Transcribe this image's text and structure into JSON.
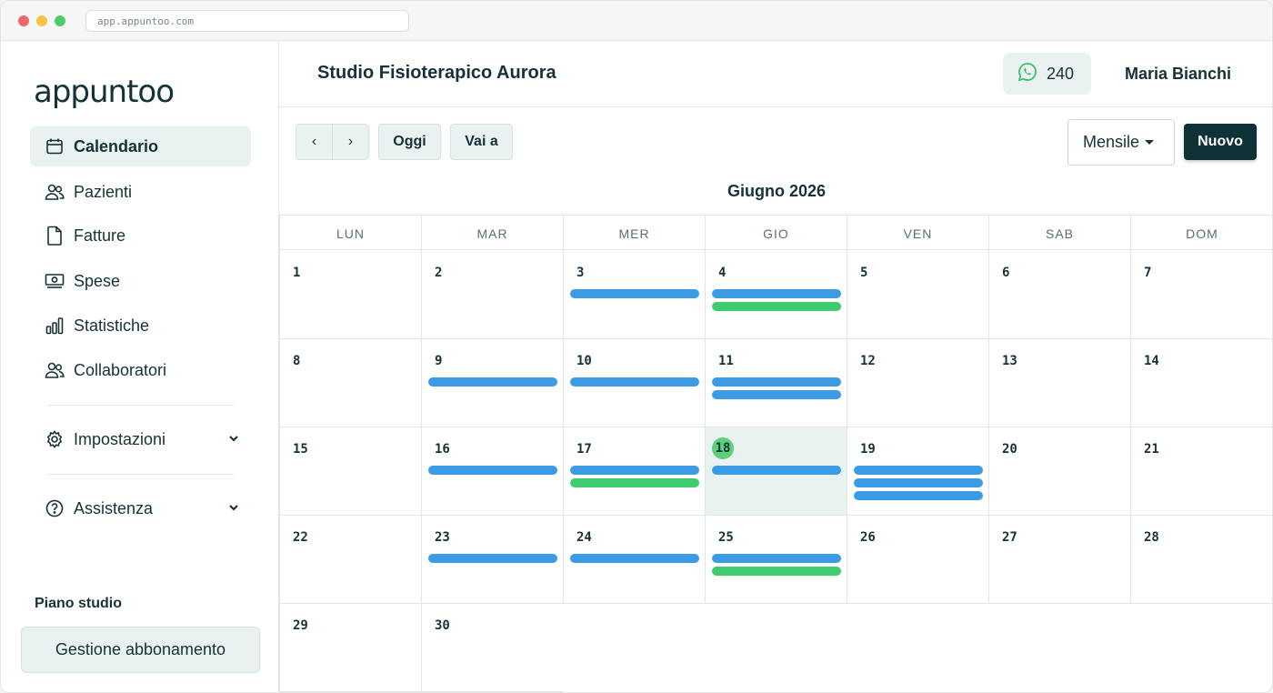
{
  "browser": {
    "url": "app.appuntoo.com"
  },
  "sidebar": {
    "logo": "appuntoo",
    "items": [
      {
        "label": "Calendario",
        "icon": "calendar-icon",
        "active": true
      },
      {
        "label": "Pazienti",
        "icon": "users-icon"
      },
      {
        "label": "Fatture",
        "icon": "document-icon"
      },
      {
        "label": "Spese",
        "icon": "banknote-icon"
      },
      {
        "label": "Statistiche",
        "icon": "bar-chart-icon"
      },
      {
        "label": "Collaboratori",
        "icon": "users-icon"
      }
    ],
    "settings": {
      "label": "Impostazioni",
      "icon": "gear-icon"
    },
    "help": {
      "label": "Assistenza",
      "icon": "help-circle-icon"
    },
    "plan_label": "Piano studio",
    "plan_button": "Gestione abbonamento"
  },
  "header": {
    "studio_name": "Studio Fisioterapico Aurora",
    "whatsapp_count": "240",
    "user_name": "Maria Bianchi"
  },
  "toolbar": {
    "prev": "‹",
    "next": "›",
    "today": "Oggi",
    "goto": "Vai a",
    "view_select": "Mensile",
    "new_button": "Nuovo"
  },
  "calendar": {
    "month_title": "Giugno 2026",
    "weekdays": [
      "LUN",
      "MAR",
      "MER",
      "GIO",
      "VEN",
      "SAB",
      "DOM"
    ],
    "today": 18,
    "days": [
      {
        "d": "1",
        "events": []
      },
      {
        "d": "2",
        "events": []
      },
      {
        "d": "3",
        "events": [
          "blue"
        ]
      },
      {
        "d": "4",
        "events": [
          "blue",
          "green"
        ]
      },
      {
        "d": "5",
        "events": []
      },
      {
        "d": "6",
        "events": []
      },
      {
        "d": "7",
        "events": []
      },
      {
        "d": "8",
        "events": []
      },
      {
        "d": "9",
        "events": [
          "blue"
        ]
      },
      {
        "d": "10",
        "events": [
          "blue"
        ]
      },
      {
        "d": "11",
        "events": [
          "blue",
          "blue"
        ]
      },
      {
        "d": "12",
        "events": []
      },
      {
        "d": "13",
        "events": []
      },
      {
        "d": "14",
        "events": []
      },
      {
        "d": "15",
        "events": []
      },
      {
        "d": "16",
        "events": [
          "blue"
        ]
      },
      {
        "d": "17",
        "events": [
          "blue",
          "green"
        ]
      },
      {
        "d": "18",
        "events": [
          "blue"
        ]
      },
      {
        "d": "19",
        "events": [
          "blue",
          "blue",
          "blue"
        ]
      },
      {
        "d": "20",
        "events": []
      },
      {
        "d": "21",
        "events": []
      },
      {
        "d": "22",
        "events": []
      },
      {
        "d": "23",
        "events": [
          "blue"
        ]
      },
      {
        "d": "24",
        "events": [
          "blue"
        ]
      },
      {
        "d": "25",
        "events": [
          "blue",
          "green"
        ]
      },
      {
        "d": "26",
        "events": []
      },
      {
        "d": "27",
        "events": []
      },
      {
        "d": "28",
        "events": []
      },
      {
        "d": "29",
        "events": []
      },
      {
        "d": "30",
        "events": []
      }
    ],
    "event_colors": {
      "blue": "#3b9be5",
      "green": "#3fcc6e"
    }
  }
}
